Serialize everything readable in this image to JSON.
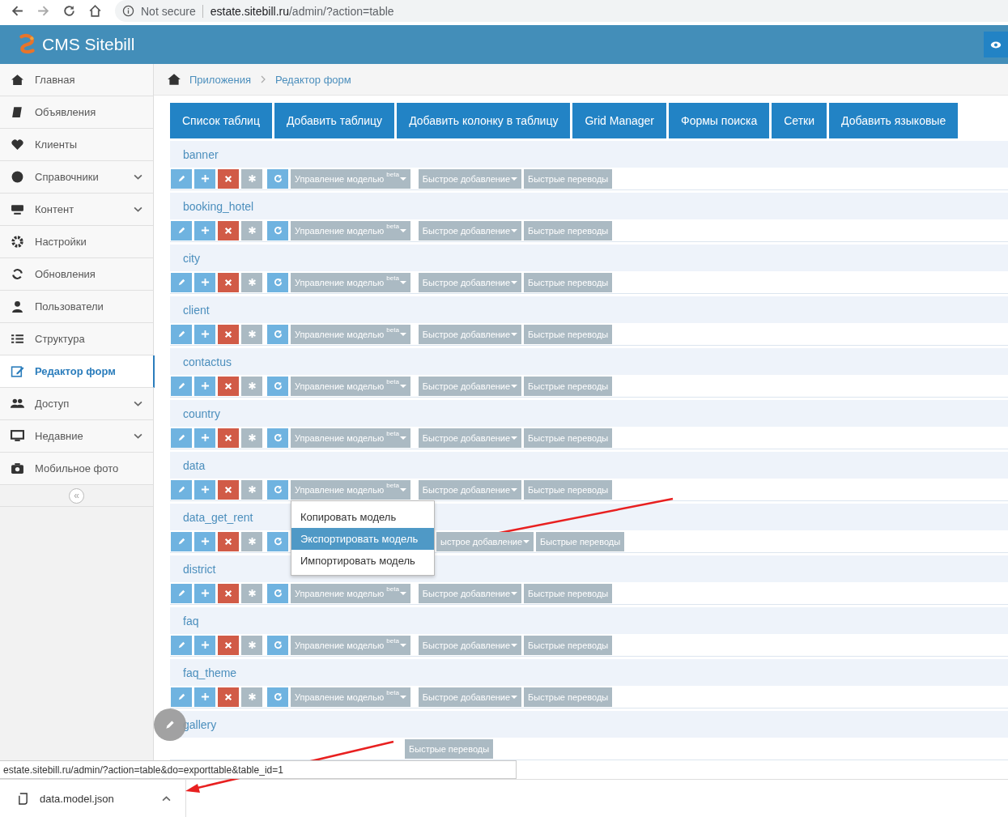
{
  "browser": {
    "security": "Not secure",
    "url_host": "estate.sitebill.ru",
    "url_path": "/admin/?action=table"
  },
  "header": {
    "title": "CMS Sitebill"
  },
  "sidebar": {
    "items": [
      {
        "label": "Главная",
        "expandable": false,
        "selected": false
      },
      {
        "label": "Объявления",
        "expandable": false,
        "selected": false
      },
      {
        "label": "Клиенты",
        "expandable": false,
        "selected": false
      },
      {
        "label": "Справочники",
        "expandable": true,
        "selected": false
      },
      {
        "label": "Контент",
        "expandable": true,
        "selected": false
      },
      {
        "label": "Настройки",
        "expandable": false,
        "selected": false
      },
      {
        "label": "Обновления",
        "expandable": false,
        "selected": false
      },
      {
        "label": "Пользователи",
        "expandable": false,
        "selected": false
      },
      {
        "label": "Структура",
        "expandable": false,
        "selected": false
      },
      {
        "label": "Редактор форм",
        "expandable": false,
        "selected": true
      },
      {
        "label": "Доступ",
        "expandable": true,
        "selected": false
      },
      {
        "label": "Недавние",
        "expandable": true,
        "selected": false
      },
      {
        "label": "Мобильное фото",
        "expandable": false,
        "selected": false
      }
    ],
    "collapse": "«"
  },
  "breadcrumb": [
    "Приложения",
    "Редактор форм"
  ],
  "tabs": [
    "Список таблиц",
    "Добавить таблицу",
    "Добавить колонку в таблицу",
    "Grid Manager",
    "Формы поиска",
    "Сетки",
    "Добавить языковые"
  ],
  "tables": [
    {
      "name": "banner",
      "model": "Управление моделью",
      "beta": "beta",
      "quick_add": "Быстрое добавление",
      "translations": "Быстрые переводы"
    },
    {
      "name": "booking_hotel",
      "model": "Управление моделью",
      "beta": "beta",
      "quick_add": "Быстрое добавление",
      "translations": "Быстрые переводы"
    },
    {
      "name": "city",
      "model": "Управление моделью",
      "beta": "beta",
      "quick_add": "Быстрое добавление",
      "translations": "Быстрые переводы"
    },
    {
      "name": "client",
      "model": "Управление моделью",
      "beta": "beta",
      "quick_add": "Быстрое добавление",
      "translations": "Быстрые переводы"
    },
    {
      "name": "contactus",
      "model": "Управление моделью",
      "beta": "beta",
      "quick_add": "Быстрое добавление",
      "translations": "Быстрые переводы"
    },
    {
      "name": "country",
      "model": "Управление моделью",
      "beta": "beta",
      "quick_add": "Быстрое добавление",
      "translations": "Быстрые переводы"
    },
    {
      "name": "data",
      "model": "Управление моделью",
      "beta": "beta",
      "quick_add": "Быстрое добавление",
      "translations": "Быстрые переводы",
      "menu": [
        {
          "label": "Копировать модель",
          "selected": false
        },
        {
          "label": "Экспортировать модель",
          "selected": true
        },
        {
          "label": "Импортировать модель",
          "selected": false
        }
      ]
    },
    {
      "name": "data_get_rent",
      "quick_add": "ыстрое добавление",
      "translations": "Быстрые переводы"
    },
    {
      "name": "district",
      "model": "Управление моделью",
      "beta": "beta",
      "quick_add": "Быстрое добавление",
      "translations": "Быстрые переводы"
    },
    {
      "name": "faq",
      "model": "Управление моделью",
      "beta": "beta",
      "quick_add": "Быстрое добавление",
      "translations": "Быстрые переводы"
    },
    {
      "name": "faq_theme",
      "model": "Управление моделью",
      "beta": "beta",
      "quick_add": "Быстрое добавление",
      "translations": "Быстрые переводы"
    },
    {
      "name": "gallery",
      "translations": "Быстрые переводы"
    }
  ],
  "status_url": "estate.sitebill.ru/admin/?action=table&do=exporttable&table_id=1",
  "download": {
    "file": "data.model.json"
  }
}
